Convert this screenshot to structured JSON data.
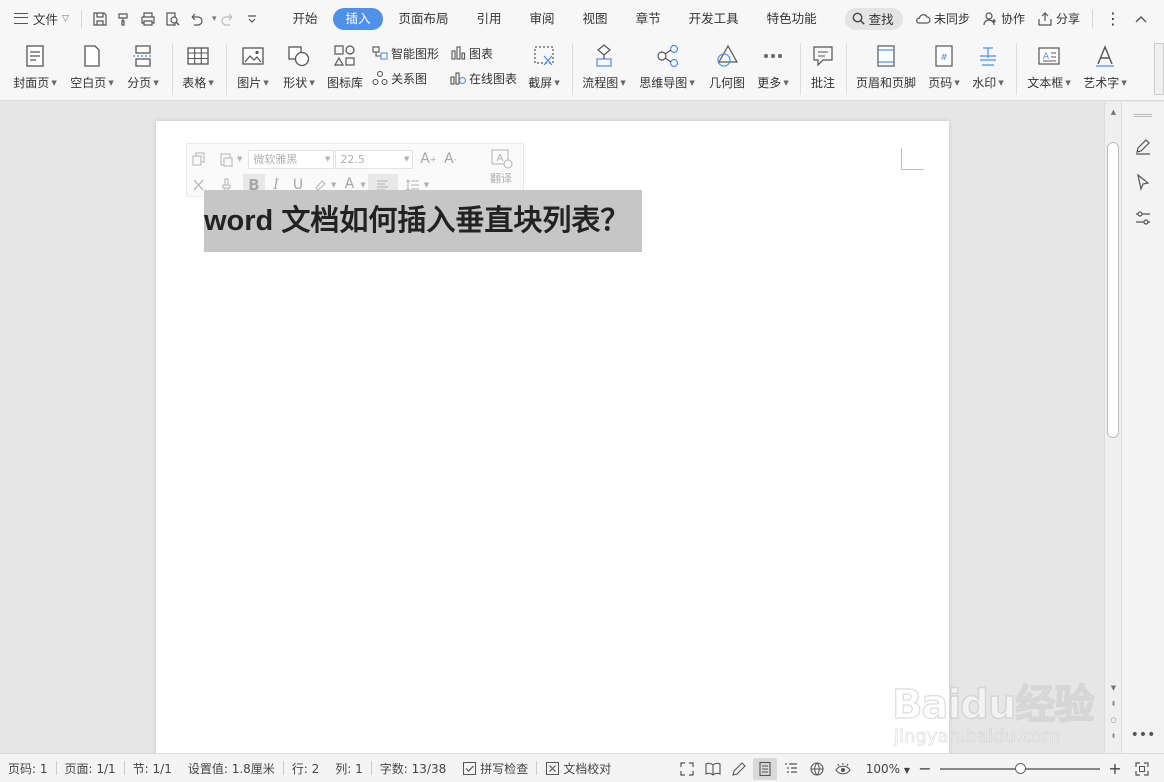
{
  "menubar": {
    "file_label": "文件",
    "tabs": [
      {
        "label": "开始",
        "active": false
      },
      {
        "label": "插入",
        "active": true
      },
      {
        "label": "页面布局",
        "active": false
      },
      {
        "label": "引用",
        "active": false
      },
      {
        "label": "审阅",
        "active": false
      },
      {
        "label": "视图",
        "active": false
      },
      {
        "label": "章节",
        "active": false
      },
      {
        "label": "开发工具",
        "active": false
      },
      {
        "label": "特色功能",
        "active": false
      }
    ],
    "search_label": "查找",
    "sync_label": "未同步",
    "collab_label": "协作",
    "share_label": "分享"
  },
  "ribbon": {
    "cover": "封面页",
    "blank": "空白页",
    "pagebreak": "分页",
    "table": "表格",
    "picture": "图片",
    "shape": "形状",
    "iconlib": "图标库",
    "smartart": "智能图形",
    "relation": "关系图",
    "chart": "图表",
    "onlinechart": "在线图表",
    "screenshot": "截屏",
    "flowchart": "流程图",
    "mindmap": "思维导图",
    "geometry": "几何图",
    "more": "更多",
    "comment": "批注",
    "headerfooter": "页眉和页脚",
    "pagenum": "页码",
    "watermark": "水印",
    "textbox": "文本框",
    "wordart": "艺术字"
  },
  "mini_toolbar": {
    "font_name": "微软雅黑",
    "font_size": "22.5",
    "translate_label": "翻译"
  },
  "document": {
    "title_text": "word 文档如何插入垂直块列表？"
  },
  "statusbar": {
    "page_code": "页码: 1",
    "page": "页面: 1/1",
    "section": "节: 1/1",
    "setting": "设置值: 1.8厘米",
    "row": "行: 2",
    "col": "列: 1",
    "wordcount": "字数: 13/38",
    "spellcheck": "拼写检查",
    "proofread": "文档校对",
    "zoom": "100%",
    "zoom_fraction": 0.5
  },
  "watermark": {
    "logo_text": "Baidu经验",
    "url_text": "jingyan.baidu.com"
  },
  "colors": {
    "accent": "#4f90e8",
    "selection": "#c6c6c6"
  }
}
